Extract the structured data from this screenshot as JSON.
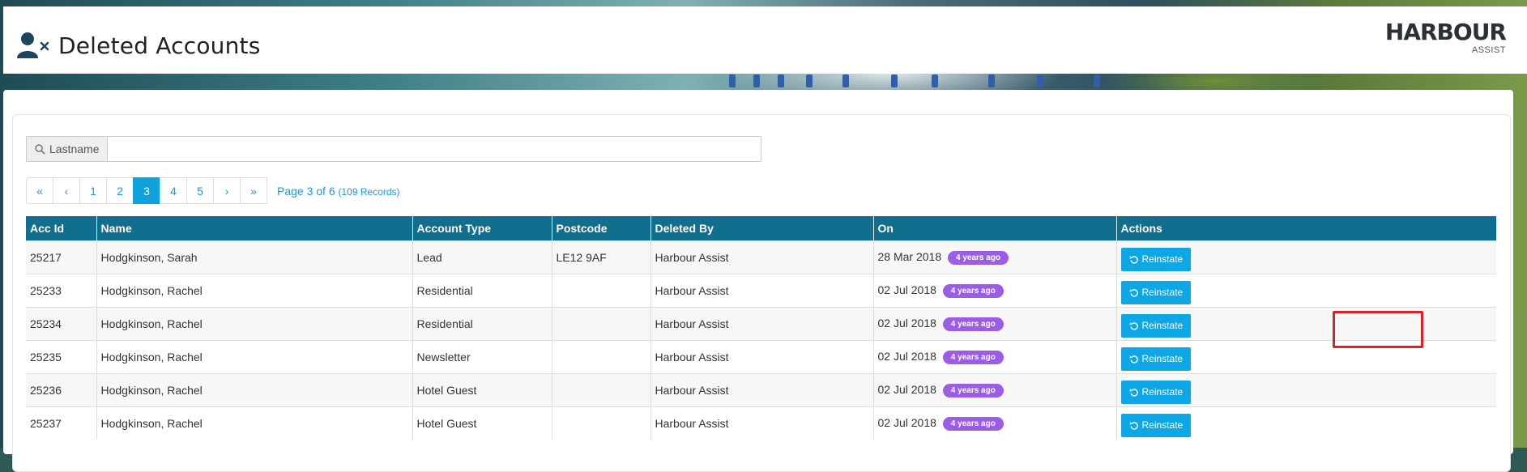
{
  "header": {
    "title": "Deleted Accounts",
    "logo_main": "HARBOUR",
    "logo_sub": "ASSIST"
  },
  "search": {
    "addon_label": "Lastname",
    "value": "",
    "placeholder": ""
  },
  "pagination": {
    "first": "«",
    "prev": "‹",
    "pages": [
      "1",
      "2",
      "3",
      "4",
      "5"
    ],
    "active_page": "3",
    "next": "›",
    "last": "»",
    "info": "Page 3 of 6",
    "records": "(109 Records)"
  },
  "table": {
    "columns": [
      "Acc Id",
      "Name",
      "Account Type",
      "Postcode",
      "Deleted By",
      "On",
      "Actions"
    ],
    "rows": [
      {
        "id": "25217",
        "name": "Hodgkinson, Sarah",
        "type": "Lead",
        "postcode": "LE12 9AF",
        "deleted_by": "Harbour Assist",
        "on": "28 Mar 2018",
        "ago": "4 years ago",
        "action": "Reinstate"
      },
      {
        "id": "25233",
        "name": "Hodgkinson, Rachel",
        "type": "Residential",
        "postcode": "",
        "deleted_by": "Harbour Assist",
        "on": "02 Jul 2018",
        "ago": "4 years ago",
        "action": "Reinstate"
      },
      {
        "id": "25234",
        "name": "Hodgkinson, Rachel",
        "type": "Residential",
        "postcode": "",
        "deleted_by": "Harbour Assist",
        "on": "02 Jul 2018",
        "ago": "4 years ago",
        "action": "Reinstate"
      },
      {
        "id": "25235",
        "name": "Hodgkinson, Rachel",
        "type": "Newsletter",
        "postcode": "",
        "deleted_by": "Harbour Assist",
        "on": "02 Jul 2018",
        "ago": "4 years ago",
        "action": "Reinstate"
      },
      {
        "id": "25236",
        "name": "Hodgkinson, Rachel",
        "type": "Hotel Guest",
        "postcode": "",
        "deleted_by": "Harbour Assist",
        "on": "02 Jul 2018",
        "ago": "4 years ago",
        "action": "Reinstate"
      },
      {
        "id": "25237",
        "name": "Hodgkinson, Rachel",
        "type": "Hotel Guest",
        "postcode": "",
        "deleted_by": "Harbour Assist",
        "on": "02 Jul 2018",
        "ago": "4 years ago",
        "action": "Reinstate"
      }
    ]
  },
  "icons": {
    "title_icon": "user-delete-icon",
    "search_icon": "search-icon",
    "action_icon": "undo-icon"
  },
  "colors": {
    "table_header": "#126e8f",
    "accent": "#0ea1db",
    "badge": "#9b5de5",
    "highlight": "#d62424"
  }
}
